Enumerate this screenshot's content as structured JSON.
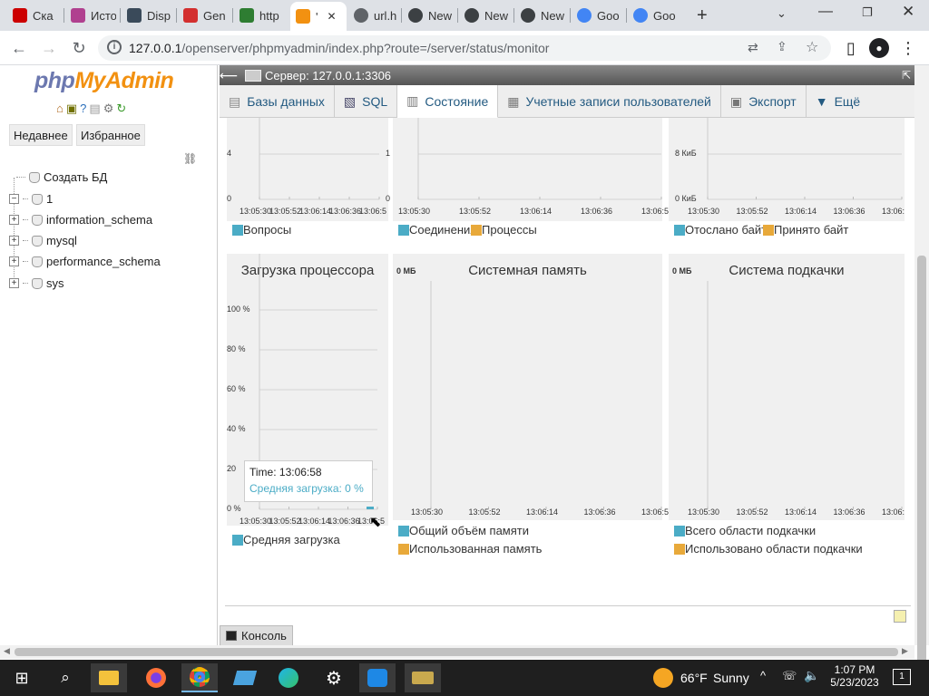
{
  "browser": {
    "tabs": [
      {
        "label": "Ска",
        "icon": "video-icon",
        "color": "#cc0000"
      },
      {
        "label": "Исто",
        "icon": "flower-icon",
        "color": "#b0408f"
      },
      {
        "label": "Disp",
        "icon": "t-icon",
        "color": "#3a4a5a"
      },
      {
        "label": "Gen",
        "icon": "f-icon",
        "color": "#d32f2f"
      },
      {
        "label": "http",
        "icon": "s-icon",
        "color": "#2e7d32"
      },
      {
        "label": "'",
        "icon": "pma-icon",
        "color": "#f29111"
      },
      {
        "label": "url.h",
        "icon": "globe-icon",
        "color": "#5f6368"
      },
      {
        "label": "New",
        "icon": "chrome-icon",
        "color": "#3c4043"
      },
      {
        "label": "New",
        "icon": "chrome-icon",
        "color": "#3c4043"
      },
      {
        "label": "New",
        "icon": "chrome-icon",
        "color": "#3c4043"
      },
      {
        "label": "Goo",
        "icon": "google-icon",
        "color": "#4285f4"
      },
      {
        "label": "Goo",
        "icon": "chrome-icon",
        "color": "#4285f4"
      }
    ],
    "url_host": "127.0.0.1",
    "url_path": "/openserver/phpmyadmin/index.php?route=/server/status/monitor"
  },
  "pma": {
    "logo_php": "php",
    "logo_myadmin": "MyAdmin",
    "recent_button": "Недавнее",
    "favorites_button": "Избранное",
    "tree": [
      "Создать БД",
      "1",
      "information_schema",
      "mysql",
      "performance_schema",
      "sys"
    ],
    "server_label": "Сервер: 127.0.0.1:3306",
    "tabs": [
      {
        "label": "Базы данных",
        "icon": "database-icon"
      },
      {
        "label": "SQL",
        "icon": "sql-icon"
      },
      {
        "label": "Состояние",
        "icon": "status-icon",
        "active": true
      },
      {
        "label": "Учетные записи пользователей",
        "icon": "users-icon"
      },
      {
        "label": "Экспорт",
        "icon": "export-icon"
      },
      {
        "label": "Ещё",
        "icon": "chevron-down-icon"
      }
    ],
    "console_label": "Консоль"
  },
  "colors": {
    "series1": "#4bacc6",
    "series2": "#e8a93a"
  },
  "chart_data": [
    {
      "type": "line",
      "title": "",
      "yticks": [
        "4",
        "0"
      ],
      "x": [
        "13:05:30",
        "13:05:52",
        "13:06:14",
        "13:06:36",
        "13:06:5"
      ],
      "series": [
        {
          "name": "Вопросы",
          "values": []
        }
      ]
    },
    {
      "type": "line",
      "title": "",
      "yticks": [
        "1",
        "0"
      ],
      "x": [
        "13:05:30",
        "13:05:52",
        "13:06:14",
        "13:06:36",
        "13:06:5"
      ],
      "series": [
        {
          "name": "Соединения",
          "values": []
        },
        {
          "name": "Процессы",
          "values": []
        }
      ]
    },
    {
      "type": "line",
      "title": "",
      "yticks": [
        "8 КиБ",
        "0 КиБ"
      ],
      "x": [
        "13:05:30",
        "13:05:52",
        "13:06:14",
        "13:06:36",
        "13:06:"
      ],
      "series": [
        {
          "name": "Отослано байт",
          "values": []
        },
        {
          "name": "Принято байт",
          "values": []
        }
      ]
    },
    {
      "type": "line",
      "title": "Загрузка процессора",
      "yticks": [
        "100 %",
        "80 %",
        "60 %",
        "40 %",
        "20",
        "0 %"
      ],
      "ylim": [
        0,
        100
      ],
      "x": [
        "13:05:30",
        "13:05:52",
        "13:06:14",
        "13:06:36",
        "13:06:5"
      ],
      "series": [
        {
          "name": "Средняя загрузка",
          "values": [
            0
          ]
        }
      ],
      "tooltip": {
        "time_label": "Time: 13:06:58",
        "value_label": "Средняя загрузка: 0 %"
      }
    },
    {
      "type": "line",
      "title": "Системная память",
      "yticks": [
        "0 МБ"
      ],
      "x": [
        "13:05:30",
        "13:05:52",
        "13:06:14",
        "13:06:36",
        "13:06:5"
      ],
      "series": [
        {
          "name": "Общий объём памяти",
          "values": []
        },
        {
          "name": "Использованная память",
          "values": []
        }
      ]
    },
    {
      "type": "line",
      "title": "Система подкачки",
      "yticks": [
        "0 МБ"
      ],
      "x": [
        "13:05:30",
        "13:05:52",
        "13:06:14",
        "13:06:36",
        "13:06:"
      ],
      "series": [
        {
          "name": "Всего области подкачки",
          "values": []
        },
        {
          "name": "Использовано области подкачки",
          "values": []
        }
      ]
    }
  ],
  "taskbar": {
    "weather_temp": "66°F",
    "weather_text": "Sunny",
    "time": "1:07 PM",
    "date": "5/23/2023",
    "notifications": "1"
  }
}
